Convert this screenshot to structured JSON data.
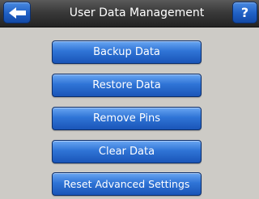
{
  "header": {
    "title": "User Data Management",
    "back_icon": "back-arrow-icon",
    "help_label": "?"
  },
  "menu": {
    "items": [
      {
        "label": "Backup Data"
      },
      {
        "label": "Restore Data"
      },
      {
        "label": "Remove Pins"
      },
      {
        "label": "Clear Data"
      },
      {
        "label": "Reset Advanced Settings"
      }
    ]
  },
  "colors": {
    "background": "#cdcbc6",
    "titlebar": "#2e2e2e",
    "button_blue": "#2f74d6",
    "button_text": "#ffffff"
  }
}
